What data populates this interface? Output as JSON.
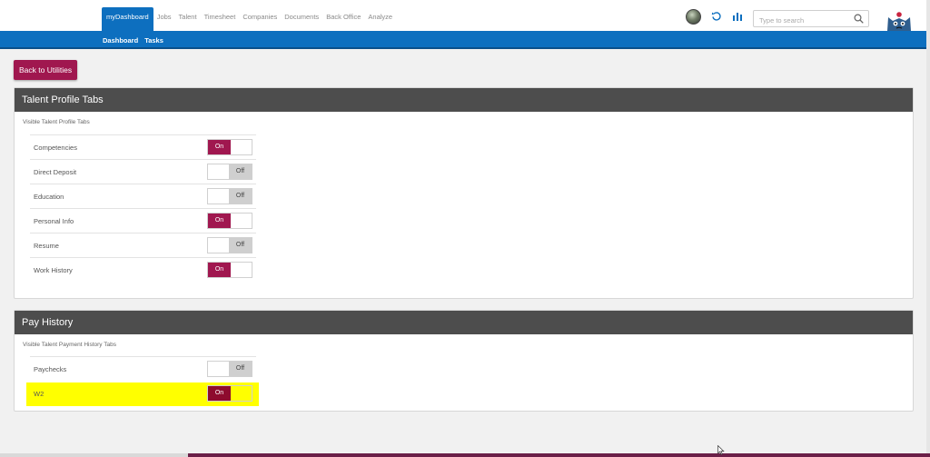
{
  "nav": {
    "items": [
      "myDashboard",
      "Jobs",
      "Talent",
      "Timesheet",
      "Companies",
      "Documents",
      "Back Office",
      "Analyze"
    ],
    "active": "myDashboard"
  },
  "subnav": {
    "items": [
      "Dashboard",
      "Tasks"
    ]
  },
  "search": {
    "placeholder": "Type to search"
  },
  "back_button": "Back to Utilities",
  "talent_profile": {
    "title": "Talent Profile Tabs",
    "subtitle": "Visible Talent Profile Tabs",
    "rows": [
      {
        "label": "Competencies",
        "state": "On"
      },
      {
        "label": "Direct Deposit",
        "state": "Off"
      },
      {
        "label": "Education",
        "state": "Off"
      },
      {
        "label": "Personal Info",
        "state": "On"
      },
      {
        "label": "Resume",
        "state": "Off"
      },
      {
        "label": "Work History",
        "state": "On"
      }
    ]
  },
  "pay_history": {
    "title": "Pay History",
    "subtitle": "Visible Talent Payment History Tabs",
    "rows": [
      {
        "label": "Paychecks",
        "state": "Off"
      },
      {
        "label": "W2",
        "state": "On"
      }
    ]
  },
  "colors": {
    "accent": "#a0174f",
    "brand_blue": "#0d6fbf",
    "header_dark": "#4d4d4d",
    "highlight": "#ffff00"
  },
  "icons": [
    "globe-icon",
    "refresh-icon",
    "stats-icon",
    "search-icon",
    "mascot-icon",
    "cursor-icon"
  ]
}
